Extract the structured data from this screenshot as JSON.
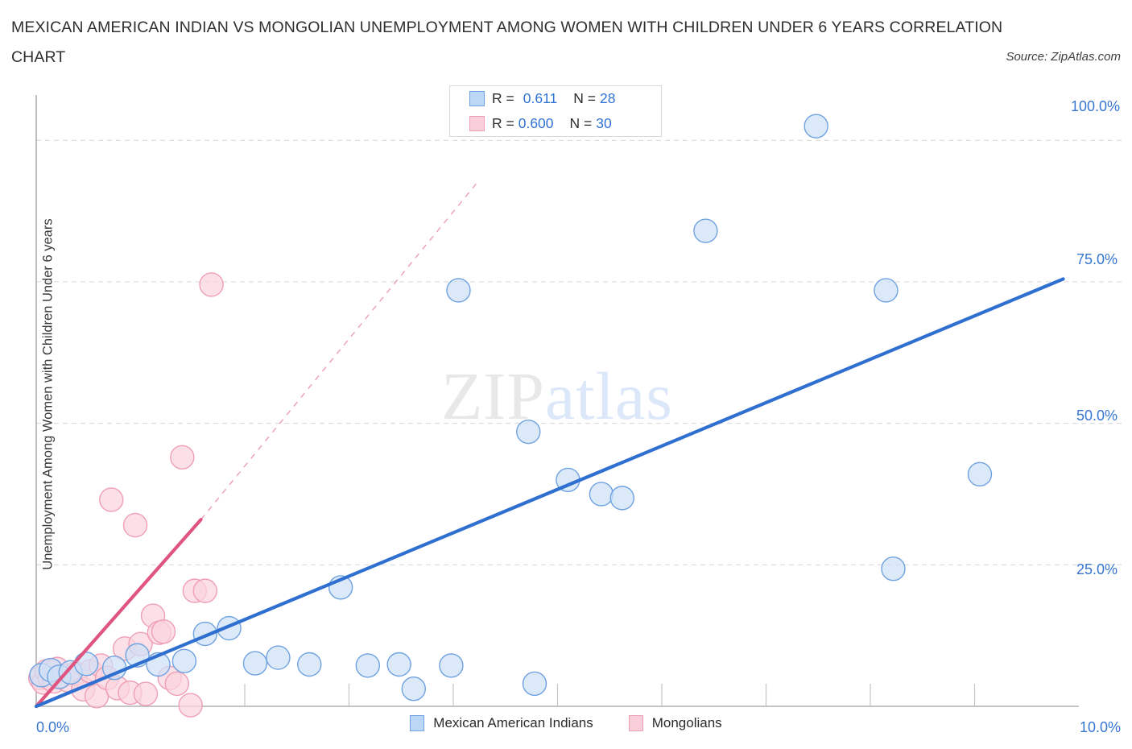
{
  "header": {
    "title_line1": "MEXICAN AMERICAN INDIAN VS MONGOLIAN UNEMPLOYMENT AMONG WOMEN WITH CHILDREN UNDER 6 YEARS CORRELATION",
    "title_line2": "CHART",
    "source": "Source: ZipAtlas.com"
  },
  "watermark": {
    "part1": "ZIP",
    "part2": "atlas"
  },
  "stats": {
    "rows": [
      {
        "series": "Mexican American Indians",
        "r_label": "R =",
        "r_value": "0.611",
        "n_label": "N =",
        "n_value": "28",
        "color": "#bcd6f5"
      },
      {
        "series": "Mongolians",
        "r_label": "R =",
        "r_value": "0.600",
        "n_label": "N =",
        "n_value": "30",
        "color": "#fbcfda"
      }
    ]
  },
  "legend": {
    "items": [
      {
        "label": "Mexican American Indians",
        "color": "#bcd6f5",
        "border": "#6fa2e0"
      },
      {
        "label": "Mongolians",
        "color": "#fbcfda",
        "border": "#efa0b6"
      }
    ]
  },
  "axes": {
    "y_title": "Unemployment Among Women with Children Under 6 years",
    "y_ticks": [
      "100.0%",
      "75.0%",
      "50.0%",
      "25.0%"
    ],
    "x_min_label": "0.0%",
    "x_max_label": "10.0%"
  },
  "chart_data": {
    "type": "scatter",
    "title": "MEXICAN AMERICAN INDIAN VS MONGOLIAN UNEMPLOYMENT AMONG WOMEN WITH CHILDREN UNDER 6 YEARS CORRELATION CHART",
    "xlabel": "",
    "ylabel": "Unemployment Among Women with Children Under 6 years",
    "xlim": [
      0,
      10
    ],
    "ylim": [
      0,
      108
    ],
    "x_unit": "%",
    "y_unit": "%",
    "grid": true,
    "gridlines_y": [
      25,
      50,
      75,
      100
    ],
    "legend_position": "bottom",
    "series": [
      {
        "name": "Mexican American Indians",
        "color": "#cfe0f7",
        "border": "#6fa2e0",
        "r": 0.611,
        "n": 28,
        "trendline": {
          "style": "solid",
          "color": "#2f6fd0",
          "x0": 0.0,
          "y0": 0.0,
          "x1": 9.85,
          "y1": 75.5
        },
        "points": [
          {
            "x": 0.05,
            "y": 5.5
          },
          {
            "x": 0.14,
            "y": 6.4
          },
          {
            "x": 0.22,
            "y": 5.2
          },
          {
            "x": 0.33,
            "y": 6.0
          },
          {
            "x": 0.48,
            "y": 7.5
          },
          {
            "x": 0.75,
            "y": 6.8
          },
          {
            "x": 0.97,
            "y": 9.0
          },
          {
            "x": 1.17,
            "y": 7.4
          },
          {
            "x": 1.42,
            "y": 8.0
          },
          {
            "x": 1.62,
            "y": 12.8
          },
          {
            "x": 1.85,
            "y": 13.8
          },
          {
            "x": 2.1,
            "y": 7.6
          },
          {
            "x": 2.32,
            "y": 8.6
          },
          {
            "x": 2.62,
            "y": 7.4
          },
          {
            "x": 2.92,
            "y": 21.0
          },
          {
            "x": 3.18,
            "y": 7.2
          },
          {
            "x": 3.48,
            "y": 7.4
          },
          {
            "x": 3.62,
            "y": 3.1
          },
          {
            "x": 3.98,
            "y": 7.2
          },
          {
            "x": 4.05,
            "y": 73.5
          },
          {
            "x": 4.72,
            "y": 48.5
          },
          {
            "x": 4.78,
            "y": 4.0
          },
          {
            "x": 5.1,
            "y": 40.0
          },
          {
            "x": 5.42,
            "y": 37.5
          },
          {
            "x": 5.62,
            "y": 36.8
          },
          {
            "x": 6.42,
            "y": 84.0
          },
          {
            "x": 7.48,
            "y": 102.5
          },
          {
            "x": 8.15,
            "y": 73.5
          },
          {
            "x": 8.22,
            "y": 24.3
          },
          {
            "x": 9.05,
            "y": 41.0
          }
        ]
      },
      {
        "name": "Mongolians",
        "color": "#fbd4de",
        "border": "#ef9fb5",
        "r": 0.6,
        "n": 30,
        "trendline": {
          "style": "solid-with-dashed-extension",
          "color": "#e0557f",
          "x0": 0.0,
          "y0": 0.0,
          "x1": 1.58,
          "y1": 33.0,
          "dash_x1": 4.25,
          "dash_y1": 93.0
        },
        "points": [
          {
            "x": 0.04,
            "y": 5.0
          },
          {
            "x": 0.07,
            "y": 4.2
          },
          {
            "x": 0.1,
            "y": 6.2
          },
          {
            "x": 0.13,
            "y": 5.0
          },
          {
            "x": 0.17,
            "y": 4.4
          },
          {
            "x": 0.2,
            "y": 6.6
          },
          {
            "x": 0.25,
            "y": 5.4
          },
          {
            "x": 0.3,
            "y": 4.6
          },
          {
            "x": 0.38,
            "y": 5.8
          },
          {
            "x": 0.45,
            "y": 3.0
          },
          {
            "x": 0.52,
            "y": 6.2
          },
          {
            "x": 0.58,
            "y": 1.8
          },
          {
            "x": 0.62,
            "y": 7.2
          },
          {
            "x": 0.68,
            "y": 5.0
          },
          {
            "x": 0.72,
            "y": 36.5
          },
          {
            "x": 0.78,
            "y": 3.2
          },
          {
            "x": 0.85,
            "y": 10.2
          },
          {
            "x": 0.9,
            "y": 2.4
          },
          {
            "x": 0.95,
            "y": 32.0
          },
          {
            "x": 1.0,
            "y": 11.0
          },
          {
            "x": 1.05,
            "y": 2.2
          },
          {
            "x": 1.12,
            "y": 16.0
          },
          {
            "x": 1.18,
            "y": 13.0
          },
          {
            "x": 1.22,
            "y": 13.2
          },
          {
            "x": 1.28,
            "y": 5.0
          },
          {
            "x": 1.35,
            "y": 4.0
          },
          {
            "x": 1.4,
            "y": 44.0
          },
          {
            "x": 1.52,
            "y": 20.4
          },
          {
            "x": 1.62,
            "y": 20.4
          },
          {
            "x": 1.48,
            "y": 0.2
          },
          {
            "x": 1.68,
            "y": 74.5
          }
        ]
      }
    ]
  }
}
